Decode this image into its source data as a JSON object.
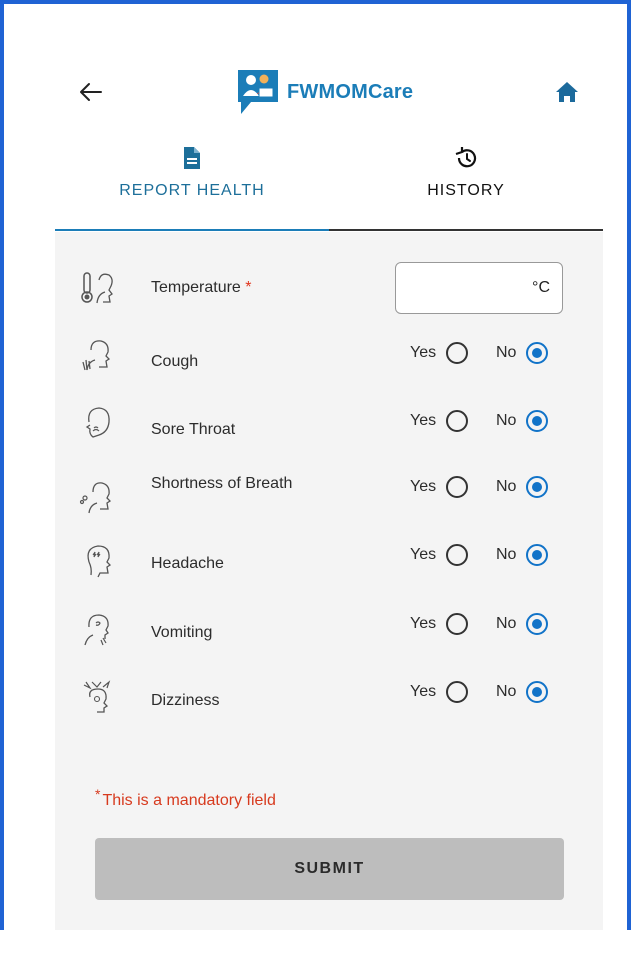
{
  "header": {
    "app_name": "FWMOMCare",
    "back_icon": "arrow-left-icon",
    "home_icon": "home-icon"
  },
  "tabs": [
    {
      "label": "REPORT HEALTH",
      "icon": "document-icon",
      "active": true
    },
    {
      "label": "HISTORY",
      "icon": "history-icon",
      "active": false
    }
  ],
  "form": {
    "temperature": {
      "label": "Temperature",
      "required_mark": "*",
      "value": "",
      "unit": "°C"
    },
    "yes_label": "Yes",
    "no_label": "No",
    "symptoms": [
      {
        "label": "Cough",
        "selected": "No"
      },
      {
        "label": "Sore Throat",
        "selected": "No"
      },
      {
        "label": "Shortness of Breath",
        "selected": "No"
      },
      {
        "label": "Headache",
        "selected": "No"
      },
      {
        "label": "Vomiting",
        "selected": "No"
      },
      {
        "label": "Dizziness",
        "selected": "No"
      }
    ],
    "mandatory_star": "*",
    "mandatory_note": "This is a mandatory field",
    "submit_label": "SUBMIT"
  },
  "colors": {
    "brand": "#1b7db8",
    "radio_selected": "#1173c8",
    "panel_bg": "#f4f4f4",
    "required": "#e0341c",
    "submit_bg": "#bdbdbd"
  }
}
